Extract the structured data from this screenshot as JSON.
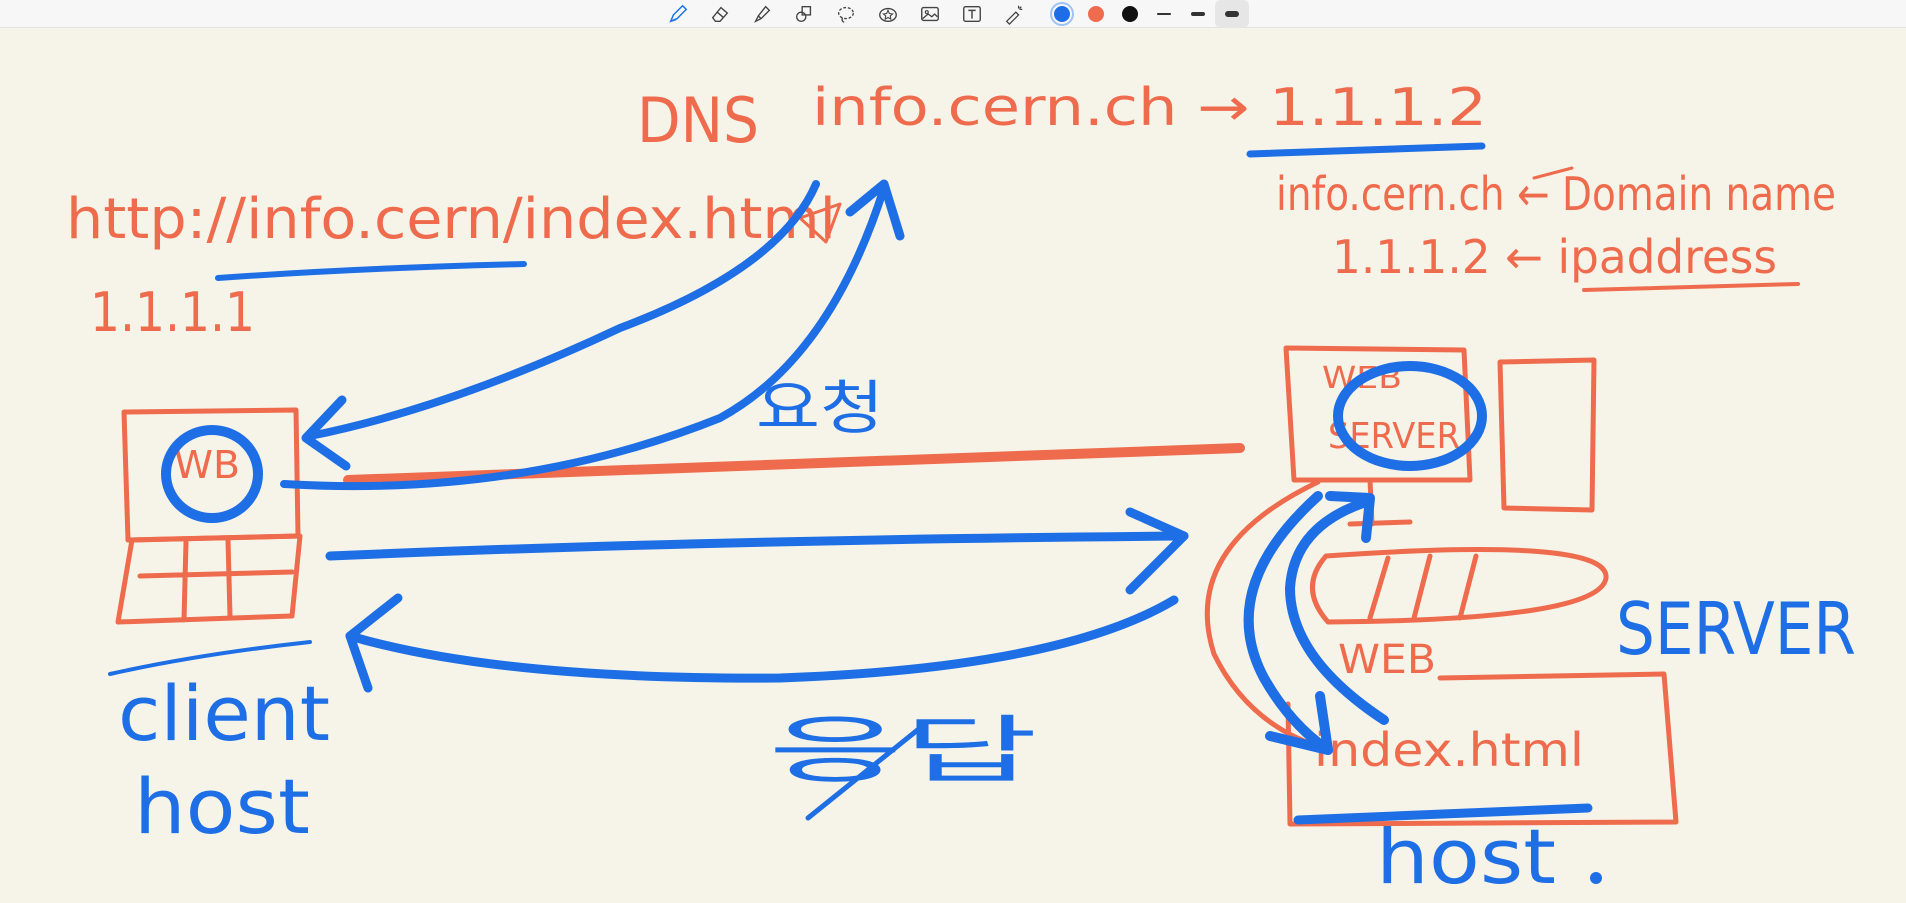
{
  "app": {
    "canvas_bg": "#f6f4e8"
  },
  "toolbar": {
    "tools": [
      {
        "name": "pen-tool",
        "icon": "pen-icon",
        "selected": true
      },
      {
        "name": "eraser-tool",
        "icon": "eraser-icon"
      },
      {
        "name": "highlighter-tool",
        "icon": "highlighter-icon"
      },
      {
        "name": "shapes-tool",
        "icon": "shapes-icon"
      },
      {
        "name": "lasso-tool",
        "icon": "lasso-icon"
      },
      {
        "name": "sticker-tool",
        "icon": "sticker-icon"
      },
      {
        "name": "image-tool",
        "icon": "image-icon"
      },
      {
        "name": "text-tool",
        "icon": "text-icon"
      },
      {
        "name": "laser-tool",
        "icon": "laser-pointer-icon"
      }
    ],
    "colors": [
      {
        "name": "blue",
        "hex": "#1e6fe6",
        "selected": true
      },
      {
        "name": "orange",
        "hex": "#ef6b4d"
      },
      {
        "name": "black",
        "hex": "#111111"
      }
    ],
    "stroke_widths": [
      "thin",
      "medium",
      "thick"
    ],
    "selected_stroke": "thick"
  },
  "ink_colors": {
    "blue": "#1e6fe6",
    "orange": "#ef6b4d"
  },
  "annotations": {
    "dns": "DNS",
    "dns_mapping": "info.cern.ch → 1.1.1.2",
    "url": "http://info.cern/index.html",
    "client_ip": "1.1.1.1",
    "domain_label": "info.cern.ch ← Domain name",
    "ip_label": "1.1.1.2 ← ipaddress",
    "request": "요청",
    "response": "응답",
    "wb": "WB",
    "web_server_1": "WEB",
    "web_server_2": "SERVER",
    "server_label": "SERVER",
    "web_folder": "WEB",
    "index_file": "index.html",
    "client_host_1": "client",
    "client_host_2": "host",
    "server_host": "host"
  }
}
